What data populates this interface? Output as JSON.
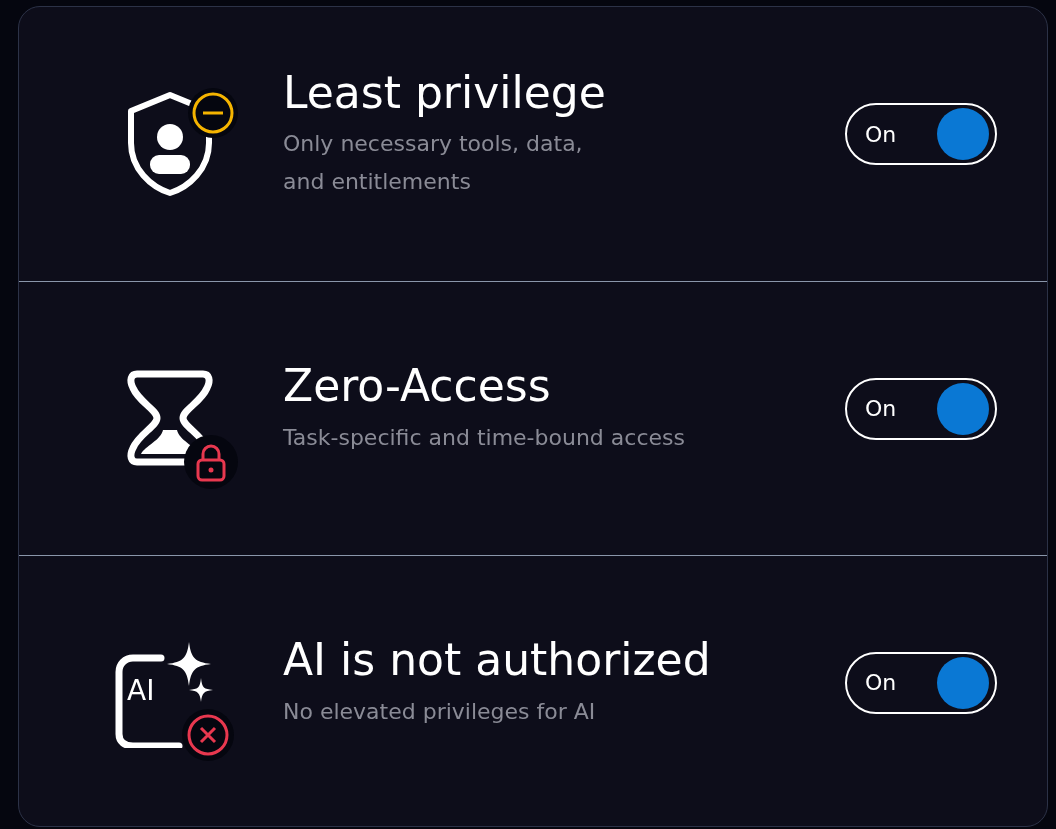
{
  "rows": [
    {
      "kind": "shield",
      "title": "Least privilege",
      "subtitle": "Only necessary tools, data,\nand entitlements",
      "toggle": {
        "label": "On",
        "on": true
      }
    },
    {
      "kind": "hourglass",
      "title": "Zero-Access",
      "subtitle": "Task-specific and time-bound access",
      "toggle": {
        "label": "On",
        "on": true
      }
    },
    {
      "kind": "ai",
      "icon_label": "AI",
      "title": "AI is not authorized",
      "subtitle": "No elevated privileges for AI",
      "toggle": {
        "label": "On",
        "on": true
      }
    }
  ]
}
